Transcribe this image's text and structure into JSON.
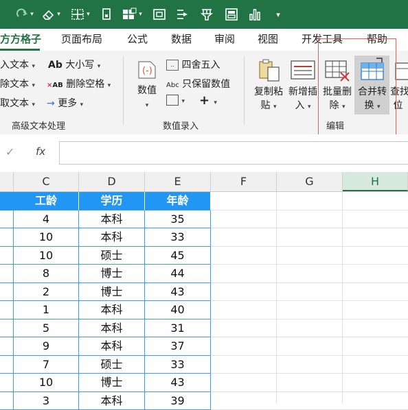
{
  "quick_access": {
    "icons": [
      "redo-icon",
      "eraser-icon",
      "borders-icon",
      "format-painter-icon",
      "table-icon",
      "screenshot-icon",
      "cursor-icon",
      "filter-icon",
      "form-icon",
      "chart-icon",
      "customize-icon"
    ]
  },
  "tabs": [
    {
      "label": "方方格子",
      "active": true
    },
    {
      "label": "页面布局"
    },
    {
      "label": "公式"
    },
    {
      "label": "数据"
    },
    {
      "label": "审阅"
    },
    {
      "label": "视图"
    },
    {
      "label": "开发工具"
    },
    {
      "label": "帮助"
    }
  ],
  "ribbon": {
    "text_group": {
      "items_left": [
        "入文本",
        "除文本",
        "取文本"
      ],
      "upper_lower": "大小写",
      "delete_space": "删除空格",
      "more": "更多",
      "label": "高级文本处理"
    },
    "number_group": {
      "value_btn": "数值",
      "round": "四舍五入",
      "keep_value": "只保留数值",
      "label": "数值录入"
    },
    "edit_group": {
      "copy_paste": [
        "复制粘",
        "贴"
      ],
      "insert": [
        "新增插",
        "入"
      ],
      "batch_delete": [
        "批量删",
        "除"
      ],
      "merge_convert": [
        "合并转",
        "换"
      ],
      "find": [
        "查找",
        "位"
      ],
      "label": "编辑"
    }
  },
  "formula_bar": {
    "check": "✓",
    "fx": "fx",
    "value": ""
  },
  "columns": [
    "C",
    "D",
    "E",
    "F",
    "G",
    "H"
  ],
  "selected_column": "H",
  "table": {
    "headers": [
      "工龄",
      "学历",
      "年龄"
    ],
    "rows": [
      [
        "4",
        "本科",
        "35"
      ],
      [
        "10",
        "本科",
        "33"
      ],
      [
        "10",
        "硕士",
        "45"
      ],
      [
        "8",
        "博士",
        "44"
      ],
      [
        "2",
        "博士",
        "43"
      ],
      [
        "1",
        "本科",
        "40"
      ],
      [
        "5",
        "本科",
        "31"
      ],
      [
        "9",
        "本科",
        "37"
      ],
      [
        "7",
        "硕士",
        "33"
      ],
      [
        "10",
        "博士",
        "43"
      ],
      [
        "3",
        "本科",
        "39"
      ]
    ]
  },
  "colors": {
    "brand": "#217346",
    "table_header": "#2196f3",
    "highlight_box": "#e06060"
  }
}
